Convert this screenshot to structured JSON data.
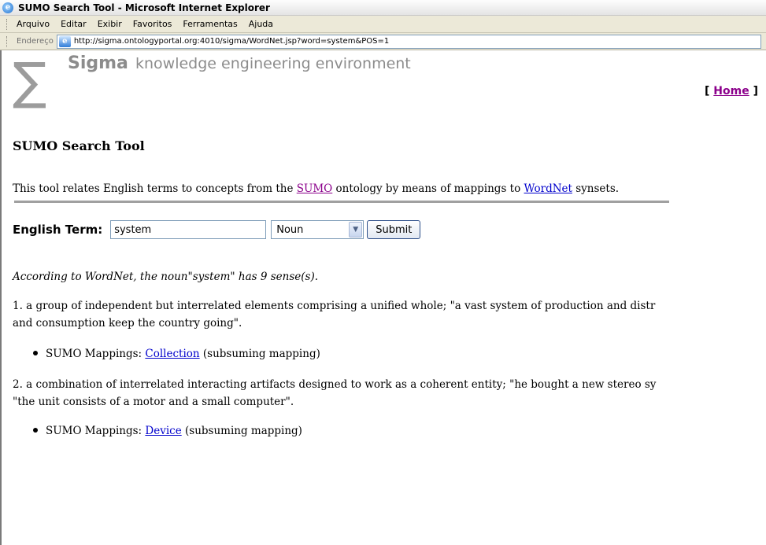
{
  "window": {
    "title": "SUMO Search Tool - Microsoft Internet Explorer",
    "icon": "ie-icon"
  },
  "menubar": {
    "items": [
      "Arquivo",
      "Editar",
      "Exibir",
      "Favoritos",
      "Ferramentas",
      "Ajuda"
    ]
  },
  "addressbar": {
    "label": "Endereço",
    "url": "http://sigma.ontologyportal.org:4010/sigma/WordNet.jsp?word=system&POS=1"
  },
  "header": {
    "brand_name": "Sigma",
    "brand_tagline": "knowledge engineering environment",
    "home_open": "[ ",
    "home_link": "Home",
    "home_close": " ]"
  },
  "page": {
    "title": "SUMO Search Tool",
    "intro_pre": "This tool relates English terms to concepts from the ",
    "intro_link1": "SUMO",
    "intro_mid": " ontology by means of mappings to ",
    "intro_link2": "WordNet",
    "intro_post": " synsets."
  },
  "form": {
    "label": "English Term:",
    "term_value": "system",
    "pos_selected": "Noun",
    "submit_label": "Submit"
  },
  "results": {
    "summary": "According to WordNet, the noun\"system\" has 9 sense(s).",
    "senses": [
      {
        "line1": "1. a group of independent but interrelated elements comprising a unified whole; \"a vast system of production and distr",
        "line2": "and consumption keep the country going\".",
        "mapping_prefix": "SUMO Mappings: ",
        "mapping_link": "Collection",
        "mapping_suffix": " (subsuming mapping)"
      },
      {
        "line1": "2. a combination of interrelated interacting artifacts designed to work as a coherent entity; \"he bought a new stereo sy",
        "line2": "\"the unit consists of a motor and a small computer\".",
        "mapping_prefix": "SUMO Mappings: ",
        "mapping_link": "Device",
        "mapping_suffix": " (subsuming mapping)"
      }
    ]
  },
  "colors": {
    "link": "#0000cc",
    "visited_link": "#8b008b",
    "brand_gray": "#8c8c8c",
    "toolbar_bg": "#ece9d8"
  }
}
